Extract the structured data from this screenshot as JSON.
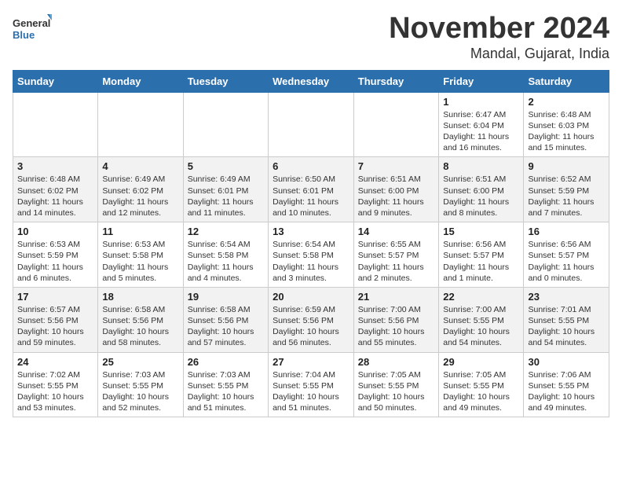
{
  "logo": {
    "general": "General",
    "blue": "Blue"
  },
  "title": "November 2024",
  "location": "Mandal, Gujarat, India",
  "weekdays": [
    "Sunday",
    "Monday",
    "Tuesday",
    "Wednesday",
    "Thursday",
    "Friday",
    "Saturday"
  ],
  "weeks": [
    [
      {
        "day": "",
        "info": ""
      },
      {
        "day": "",
        "info": ""
      },
      {
        "day": "",
        "info": ""
      },
      {
        "day": "",
        "info": ""
      },
      {
        "day": "",
        "info": ""
      },
      {
        "day": "1",
        "info": "Sunrise: 6:47 AM\nSunset: 6:04 PM\nDaylight: 11 hours\nand 16 minutes."
      },
      {
        "day": "2",
        "info": "Sunrise: 6:48 AM\nSunset: 6:03 PM\nDaylight: 11 hours\nand 15 minutes."
      }
    ],
    [
      {
        "day": "3",
        "info": "Sunrise: 6:48 AM\nSunset: 6:02 PM\nDaylight: 11 hours\nand 14 minutes."
      },
      {
        "day": "4",
        "info": "Sunrise: 6:49 AM\nSunset: 6:02 PM\nDaylight: 11 hours\nand 12 minutes."
      },
      {
        "day": "5",
        "info": "Sunrise: 6:49 AM\nSunset: 6:01 PM\nDaylight: 11 hours\nand 11 minutes."
      },
      {
        "day": "6",
        "info": "Sunrise: 6:50 AM\nSunset: 6:01 PM\nDaylight: 11 hours\nand 10 minutes."
      },
      {
        "day": "7",
        "info": "Sunrise: 6:51 AM\nSunset: 6:00 PM\nDaylight: 11 hours\nand 9 minutes."
      },
      {
        "day": "8",
        "info": "Sunrise: 6:51 AM\nSunset: 6:00 PM\nDaylight: 11 hours\nand 8 minutes."
      },
      {
        "day": "9",
        "info": "Sunrise: 6:52 AM\nSunset: 5:59 PM\nDaylight: 11 hours\nand 7 minutes."
      }
    ],
    [
      {
        "day": "10",
        "info": "Sunrise: 6:53 AM\nSunset: 5:59 PM\nDaylight: 11 hours\nand 6 minutes."
      },
      {
        "day": "11",
        "info": "Sunrise: 6:53 AM\nSunset: 5:58 PM\nDaylight: 11 hours\nand 5 minutes."
      },
      {
        "day": "12",
        "info": "Sunrise: 6:54 AM\nSunset: 5:58 PM\nDaylight: 11 hours\nand 4 minutes."
      },
      {
        "day": "13",
        "info": "Sunrise: 6:54 AM\nSunset: 5:58 PM\nDaylight: 11 hours\nand 3 minutes."
      },
      {
        "day": "14",
        "info": "Sunrise: 6:55 AM\nSunset: 5:57 PM\nDaylight: 11 hours\nand 2 minutes."
      },
      {
        "day": "15",
        "info": "Sunrise: 6:56 AM\nSunset: 5:57 PM\nDaylight: 11 hours\nand 1 minute."
      },
      {
        "day": "16",
        "info": "Sunrise: 6:56 AM\nSunset: 5:57 PM\nDaylight: 11 hours\nand 0 minutes."
      }
    ],
    [
      {
        "day": "17",
        "info": "Sunrise: 6:57 AM\nSunset: 5:56 PM\nDaylight: 10 hours\nand 59 minutes."
      },
      {
        "day": "18",
        "info": "Sunrise: 6:58 AM\nSunset: 5:56 PM\nDaylight: 10 hours\nand 58 minutes."
      },
      {
        "day": "19",
        "info": "Sunrise: 6:58 AM\nSunset: 5:56 PM\nDaylight: 10 hours\nand 57 minutes."
      },
      {
        "day": "20",
        "info": "Sunrise: 6:59 AM\nSunset: 5:56 PM\nDaylight: 10 hours\nand 56 minutes."
      },
      {
        "day": "21",
        "info": "Sunrise: 7:00 AM\nSunset: 5:56 PM\nDaylight: 10 hours\nand 55 minutes."
      },
      {
        "day": "22",
        "info": "Sunrise: 7:00 AM\nSunset: 5:55 PM\nDaylight: 10 hours\nand 54 minutes."
      },
      {
        "day": "23",
        "info": "Sunrise: 7:01 AM\nSunset: 5:55 PM\nDaylight: 10 hours\nand 54 minutes."
      }
    ],
    [
      {
        "day": "24",
        "info": "Sunrise: 7:02 AM\nSunset: 5:55 PM\nDaylight: 10 hours\nand 53 minutes."
      },
      {
        "day": "25",
        "info": "Sunrise: 7:03 AM\nSunset: 5:55 PM\nDaylight: 10 hours\nand 52 minutes."
      },
      {
        "day": "26",
        "info": "Sunrise: 7:03 AM\nSunset: 5:55 PM\nDaylight: 10 hours\nand 51 minutes."
      },
      {
        "day": "27",
        "info": "Sunrise: 7:04 AM\nSunset: 5:55 PM\nDaylight: 10 hours\nand 51 minutes."
      },
      {
        "day": "28",
        "info": "Sunrise: 7:05 AM\nSunset: 5:55 PM\nDaylight: 10 hours\nand 50 minutes."
      },
      {
        "day": "29",
        "info": "Sunrise: 7:05 AM\nSunset: 5:55 PM\nDaylight: 10 hours\nand 49 minutes."
      },
      {
        "day": "30",
        "info": "Sunrise: 7:06 AM\nSunset: 5:55 PM\nDaylight: 10 hours\nand 49 minutes."
      }
    ]
  ]
}
